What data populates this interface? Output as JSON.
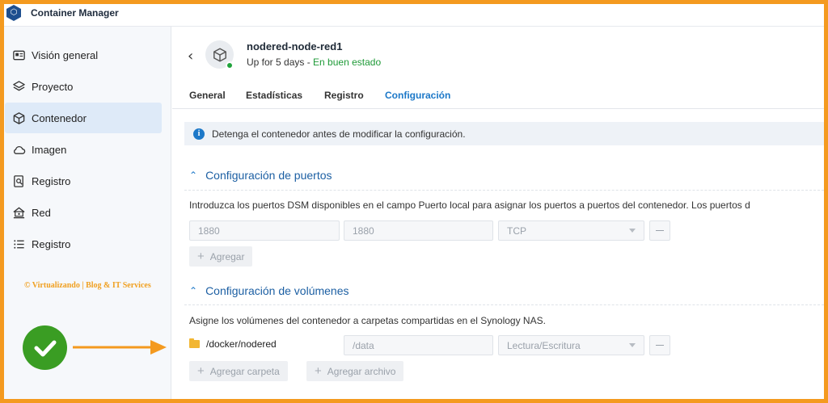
{
  "app": {
    "title": "Container Manager",
    "logo_icon": "container-manager-logo-icon"
  },
  "sidebar": {
    "items": [
      {
        "label": "Visión general",
        "icon": "overview-icon",
        "active": false
      },
      {
        "label": "Proyecto",
        "icon": "layers-icon",
        "active": false
      },
      {
        "label": "Contenedor",
        "icon": "cube-icon",
        "active": true
      },
      {
        "label": "Imagen",
        "icon": "cloud-icon",
        "active": false
      },
      {
        "label": "Registro",
        "icon": "registry-search-icon",
        "active": false
      },
      {
        "label": "Red",
        "icon": "network-icon",
        "active": false
      },
      {
        "label": "Registro",
        "icon": "list-icon",
        "active": false
      }
    ],
    "watermark": "© Virtualizando | Blog & IT Services"
  },
  "container": {
    "name": "nodered-node-red1",
    "uptime": "Up for 5 days",
    "separator": " - ",
    "health": "En buen estado",
    "status_color": "#20a33c"
  },
  "tabs": [
    {
      "label": "General",
      "active": false
    },
    {
      "label": "Estadísticas",
      "active": false
    },
    {
      "label": "Registro",
      "active": false
    },
    {
      "label": "Configuración",
      "active": true
    }
  ],
  "info_message": "Detenga el contenedor antes de modificar la configuración.",
  "ports": {
    "title": "Configuración de puertos",
    "description": "Introduzca los puertos DSM disponibles en el campo Puerto local para asignar los puertos a puertos del contenedor. Los puertos d",
    "local_port": "1880",
    "container_port": "1880",
    "protocol": "TCP",
    "add_label": "Agregar"
  },
  "volumes": {
    "title": "Configuración de volúmenes",
    "description": "Asigne los volúmenes del contenedor a carpetas compartidas en el Synology NAS.",
    "folder": "/docker/nodered",
    "mount_path": "/data",
    "permission": "Lectura/Escritura",
    "add_folder_label": "Agregar carpeta",
    "add_file_label": "Agregar archivo"
  },
  "colors": {
    "accent": "#1c78c8",
    "frame": "#f49a1f",
    "success": "#3a9d23"
  }
}
